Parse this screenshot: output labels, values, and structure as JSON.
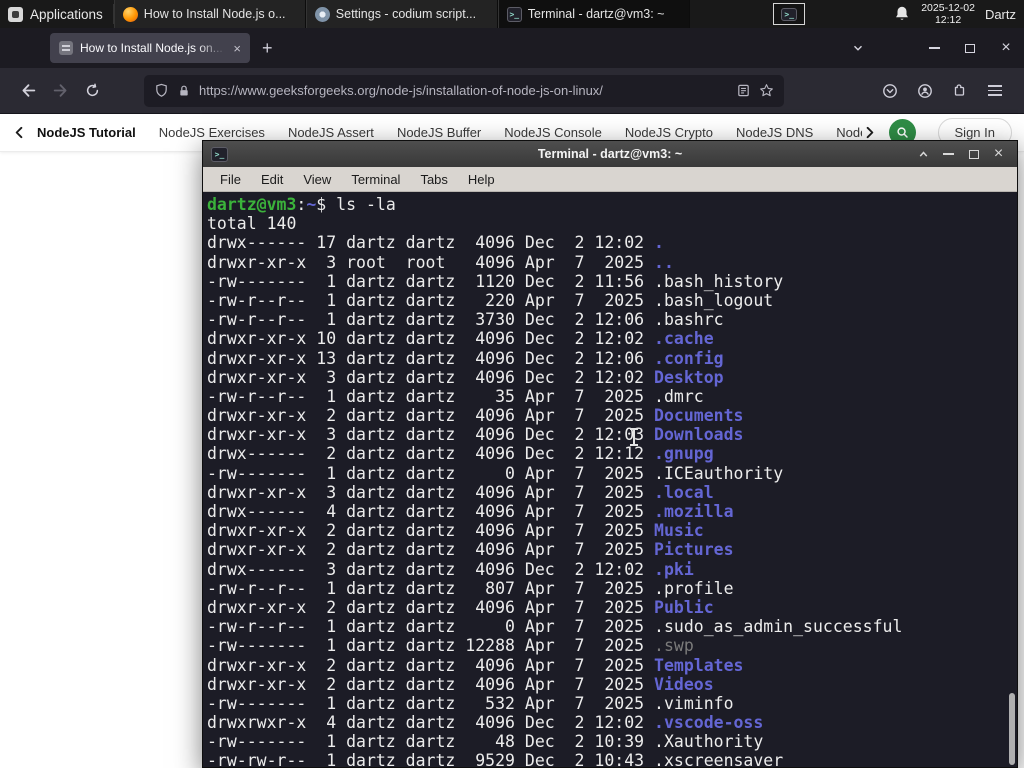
{
  "colors": {
    "gfg_green": "#2f8d46",
    "terminal_green": "#3bb33b",
    "terminal_blue": "#6466d4",
    "terminal_dim": "#7b7b7b",
    "terminal_fg": "#ececec",
    "terminal_bg": "#1c1c26"
  },
  "panel": {
    "applications": "Applications",
    "tasks": [
      {
        "title": "How to Install Node.js o...",
        "icon": "firefox-icon",
        "active": false
      },
      {
        "title": "Settings - codium script...",
        "icon": "settings-icon",
        "active": false
      },
      {
        "title": "Terminal - dartz@vm3: ~",
        "icon": "terminal-icon",
        "active": true
      }
    ],
    "date": "2025-12-02",
    "time": "12:12",
    "user": "Dartz"
  },
  "browser": {
    "tab": {
      "title": "How to Install Node.js on..."
    },
    "new_tab": "+",
    "url": "https://www.geeksforgeeks.org/node-js/installation-of-node-js-on-linux/",
    "nav_items": [
      {
        "label": "NodeJS Tutorial",
        "bold": true
      },
      {
        "label": "NodeJS Exercises",
        "bold": false
      },
      {
        "label": "NodeJS Assert",
        "bold": false
      },
      {
        "label": "NodeJS Buffer",
        "bold": false
      },
      {
        "label": "NodeJS Console",
        "bold": false
      },
      {
        "label": "NodeJS Crypto",
        "bold": false
      },
      {
        "label": "NodeJS DNS",
        "bold": false
      },
      {
        "label": "Node",
        "bold": false
      }
    ],
    "sign_in": "Sign In"
  },
  "terminal": {
    "window_title": "Terminal - dartz@vm3: ~",
    "menu": [
      "File",
      "Edit",
      "View",
      "Terminal",
      "Tabs",
      "Help"
    ],
    "prompt": {
      "user_host": "dartz@vm3",
      "colon": ":",
      "path": "~",
      "dollar": "$ ",
      "command": "ls -la"
    },
    "total": "total 140",
    "listing": [
      {
        "pre": "drwx------ 17 dartz dartz  4096 Dec  2 12:02 ",
        "name": ".",
        "type": "dir"
      },
      {
        "pre": "drwxr-xr-x  3 root  root   4096 Apr  7  2025 ",
        "name": "..",
        "type": "dir"
      },
      {
        "pre": "-rw-------  1 dartz dartz  1120 Dec  2 11:56 ",
        "name": ".bash_history",
        "type": "file"
      },
      {
        "pre": "-rw-r--r--  1 dartz dartz   220 Apr  7  2025 ",
        "name": ".bash_logout",
        "type": "file"
      },
      {
        "pre": "-rw-r--r--  1 dartz dartz  3730 Dec  2 12:06 ",
        "name": ".bashrc",
        "type": "file"
      },
      {
        "pre": "drwxr-xr-x 10 dartz dartz  4096 Dec  2 12:02 ",
        "name": ".cache",
        "type": "dir"
      },
      {
        "pre": "drwxr-xr-x 13 dartz dartz  4096 Dec  2 12:06 ",
        "name": ".config",
        "type": "dir"
      },
      {
        "pre": "drwxr-xr-x  3 dartz dartz  4096 Dec  2 12:02 ",
        "name": "Desktop",
        "type": "dir"
      },
      {
        "pre": "-rw-r--r--  1 dartz dartz    35 Apr  7  2025 ",
        "name": ".dmrc",
        "type": "file"
      },
      {
        "pre": "drwxr-xr-x  2 dartz dartz  4096 Apr  7  2025 ",
        "name": "Documents",
        "type": "dir"
      },
      {
        "pre": "drwxr-xr-x  3 dartz dartz  4096 Dec  2 12:03 ",
        "name": "Downloads",
        "type": "dir"
      },
      {
        "pre": "drwx------  2 dartz dartz  4096 Dec  2 12:12 ",
        "name": ".gnupg",
        "type": "dir"
      },
      {
        "pre": "-rw-------  1 dartz dartz     0 Apr  7  2025 ",
        "name": ".ICEauthority",
        "type": "file"
      },
      {
        "pre": "drwxr-xr-x  3 dartz dartz  4096 Apr  7  2025 ",
        "name": ".local",
        "type": "dir"
      },
      {
        "pre": "drwx------  4 dartz dartz  4096 Apr  7  2025 ",
        "name": ".mozilla",
        "type": "dir"
      },
      {
        "pre": "drwxr-xr-x  2 dartz dartz  4096 Apr  7  2025 ",
        "name": "Music",
        "type": "dir"
      },
      {
        "pre": "drwxr-xr-x  2 dartz dartz  4096 Apr  7  2025 ",
        "name": "Pictures",
        "type": "dir"
      },
      {
        "pre": "drwx------  3 dartz dartz  4096 Dec  2 12:02 ",
        "name": ".pki",
        "type": "dir"
      },
      {
        "pre": "-rw-r--r--  1 dartz dartz   807 Apr  7  2025 ",
        "name": ".profile",
        "type": "file"
      },
      {
        "pre": "drwxr-xr-x  2 dartz dartz  4096 Apr  7  2025 ",
        "name": "Public",
        "type": "dir"
      },
      {
        "pre": "-rw-r--r--  1 dartz dartz     0 Apr  7  2025 ",
        "name": ".sudo_as_admin_successful",
        "type": "file"
      },
      {
        "pre": "-rw-------  1 dartz dartz 12288 Apr  7  2025 ",
        "name": ".swp",
        "type": "dim"
      },
      {
        "pre": "drwxr-xr-x  2 dartz dartz  4096 Apr  7  2025 ",
        "name": "Templates",
        "type": "dir"
      },
      {
        "pre": "drwxr-xr-x  2 dartz dartz  4096 Apr  7  2025 ",
        "name": "Videos",
        "type": "dir"
      },
      {
        "pre": "-rw-------  1 dartz dartz   532 Apr  7  2025 ",
        "name": ".viminfo",
        "type": "file"
      },
      {
        "pre": "drwxrwxr-x  4 dartz dartz  4096 Dec  2 12:02 ",
        "name": ".vscode-oss",
        "type": "dir"
      },
      {
        "pre": "-rw-------  1 dartz dartz    48 Dec  2 10:39 ",
        "name": ".Xauthority",
        "type": "file"
      },
      {
        "pre": "-rw-rw-r--  1 dartz dartz  9529 Dec  2 10:43 ",
        "name": ".xscreensaver",
        "type": "file"
      }
    ]
  }
}
